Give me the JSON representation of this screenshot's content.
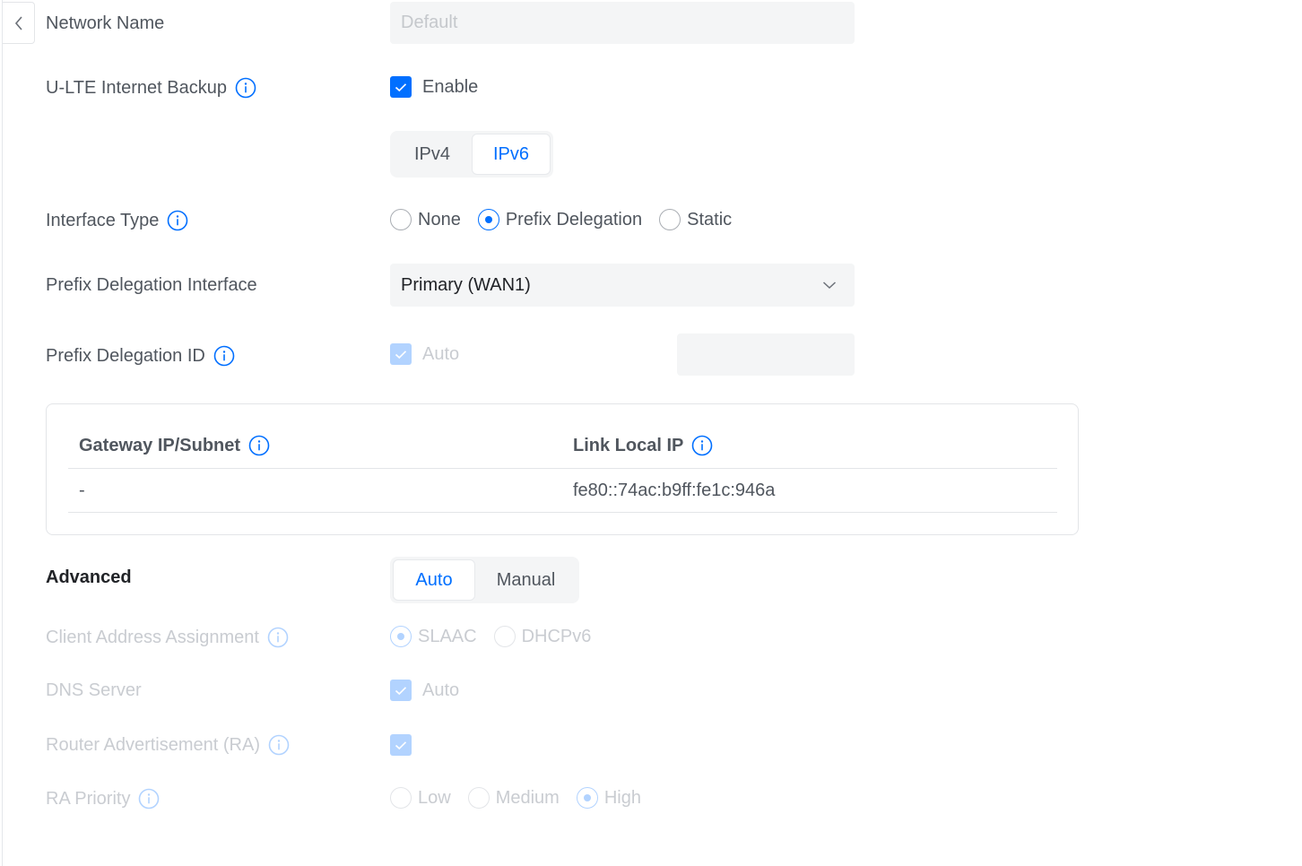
{
  "network_name": {
    "label": "Network Name",
    "placeholder": "Default"
  },
  "ulte_backup": {
    "label": "U-LTE Internet Backup",
    "checkbox_label": "Enable",
    "checked": true
  },
  "ip_version_tabs": [
    {
      "label": "IPv4",
      "active": false
    },
    {
      "label": "IPv6",
      "active": true
    }
  ],
  "interface_type": {
    "label": "Interface Type",
    "options": [
      {
        "label": "None",
        "selected": false
      },
      {
        "label": "Prefix Delegation",
        "selected": true
      },
      {
        "label": "Static",
        "selected": false
      }
    ]
  },
  "prefix_delegation_interface": {
    "label": "Prefix Delegation Interface",
    "value": "Primary (WAN1)"
  },
  "prefix_delegation_id": {
    "label": "Prefix Delegation ID",
    "auto_label": "Auto",
    "auto_checked": true
  },
  "ip_table": {
    "headers": {
      "gateway": "Gateway IP/Subnet",
      "link_local": "Link Local IP"
    },
    "row": {
      "gateway": "-",
      "link_local": "fe80::74ac:b9ff:fe1c:946a"
    }
  },
  "advanced": {
    "label": "Advanced",
    "tabs": [
      {
        "label": "Auto",
        "active": true
      },
      {
        "label": "Manual",
        "active": false
      }
    ]
  },
  "client_address_assignment": {
    "label": "Client Address Assignment",
    "options": [
      {
        "label": "SLAAC",
        "selected": true
      },
      {
        "label": "DHCPv6",
        "selected": false
      }
    ]
  },
  "dns_server": {
    "label": "DNS Server",
    "auto_label": "Auto",
    "checked": true
  },
  "router_advertisement": {
    "label": "Router Advertisement (RA)",
    "checked": true
  },
  "ra_priority": {
    "label": "RA Priority",
    "options": [
      {
        "label": "Low",
        "selected": false
      },
      {
        "label": "Medium",
        "selected": false
      },
      {
        "label": "High",
        "selected": true
      }
    ]
  },
  "colors": {
    "accent": "#006fff",
    "accent_disabled": "#b2d3ff",
    "text": "#50565e",
    "text_disabled": "#c9ccd1",
    "field_bg": "#f4f5f6"
  },
  "icons": {
    "back": "chevron-left-icon",
    "info": "info-icon",
    "check": "check-icon",
    "dropdown": "chevron-down-icon"
  }
}
